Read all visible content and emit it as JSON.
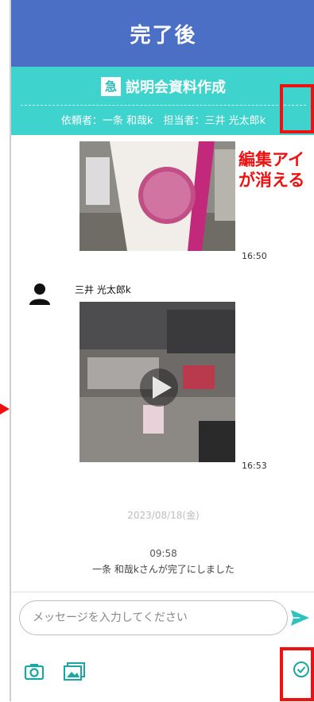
{
  "screen": {
    "title": "完了後"
  },
  "task": {
    "urgent_badge": "急",
    "title": "説明会資料作成",
    "meta": "依頼者：一条 和哉k　担当者：三井 光太郎k"
  },
  "annotation": {
    "line1": "編集アイ",
    "line2": "が消える"
  },
  "messages": [
    {
      "time": "16:50"
    },
    {
      "sender": "三井 光太郎k",
      "time": "16:53"
    }
  ],
  "date_separator": "2023/08/18(金)",
  "system_message": {
    "time": "09:58",
    "text": "一条 和哉kさんが完了にしました"
  },
  "composer": {
    "placeholder": "メッセージを入力してください"
  },
  "icons": {
    "camera": "camera-icon",
    "gallery": "image-icon",
    "send": "send-icon",
    "complete": "check-circle-icon",
    "avatar": "person-icon",
    "play": "play-icon"
  },
  "colors": {
    "title_bar": "#4a6fc5",
    "task_header": "#3fd3ce",
    "accent": "#2bb8b3",
    "annotation": "#ee1111"
  }
}
